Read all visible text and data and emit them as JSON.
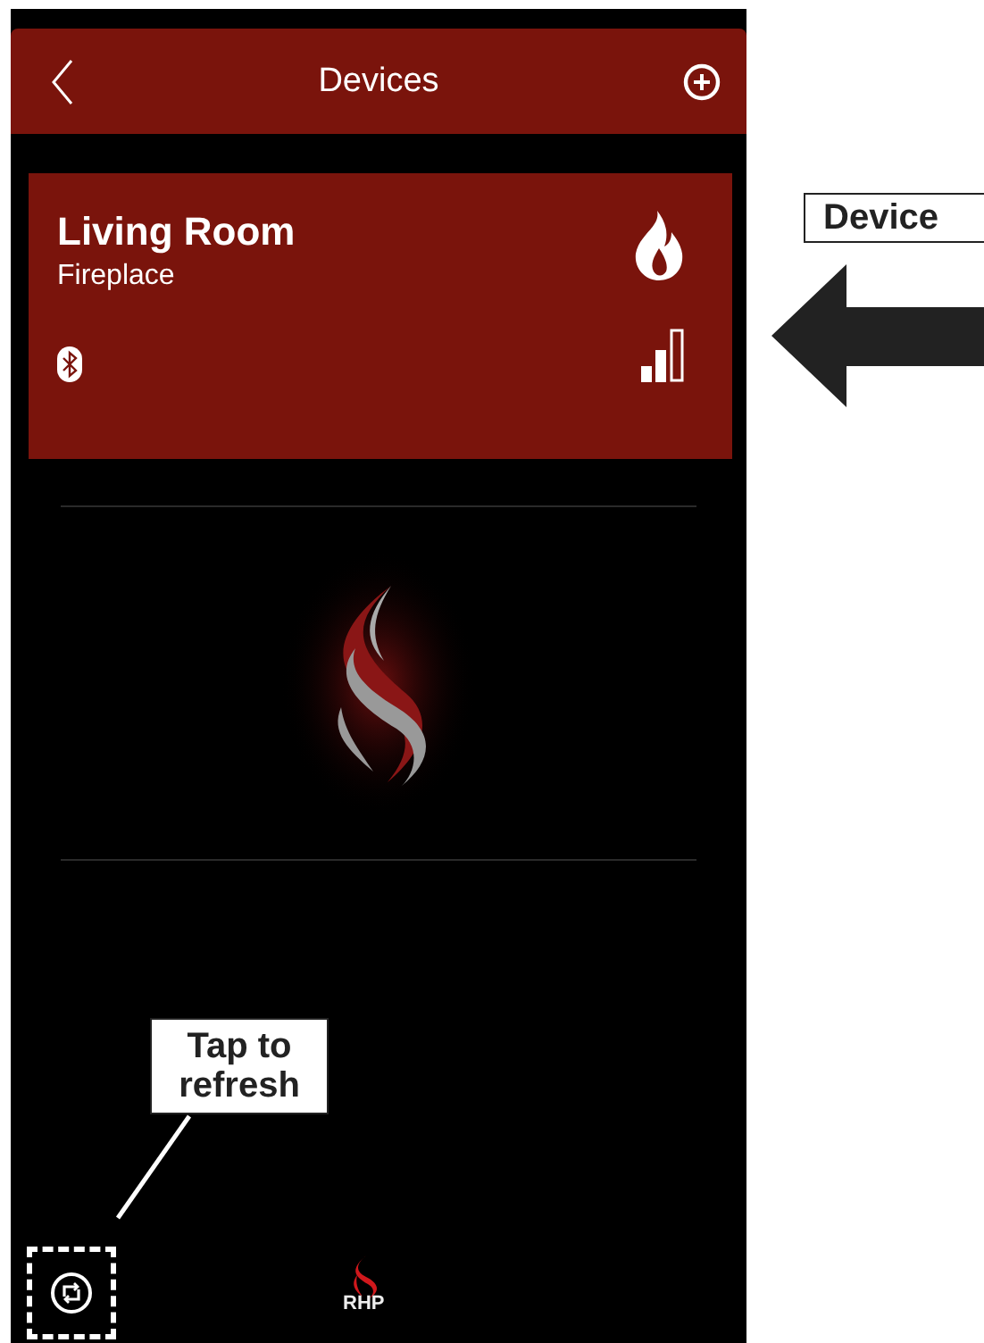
{
  "header": {
    "title": "Devices"
  },
  "devices": [
    {
      "name": "Living Room",
      "type": "Fireplace"
    }
  ],
  "footer": {
    "logo_text": "RHP"
  },
  "annotations": [
    {
      "kind": "arrow-label",
      "text": "Device"
    },
    {
      "kind": "callout",
      "text": "Tap to refresh"
    }
  ]
}
